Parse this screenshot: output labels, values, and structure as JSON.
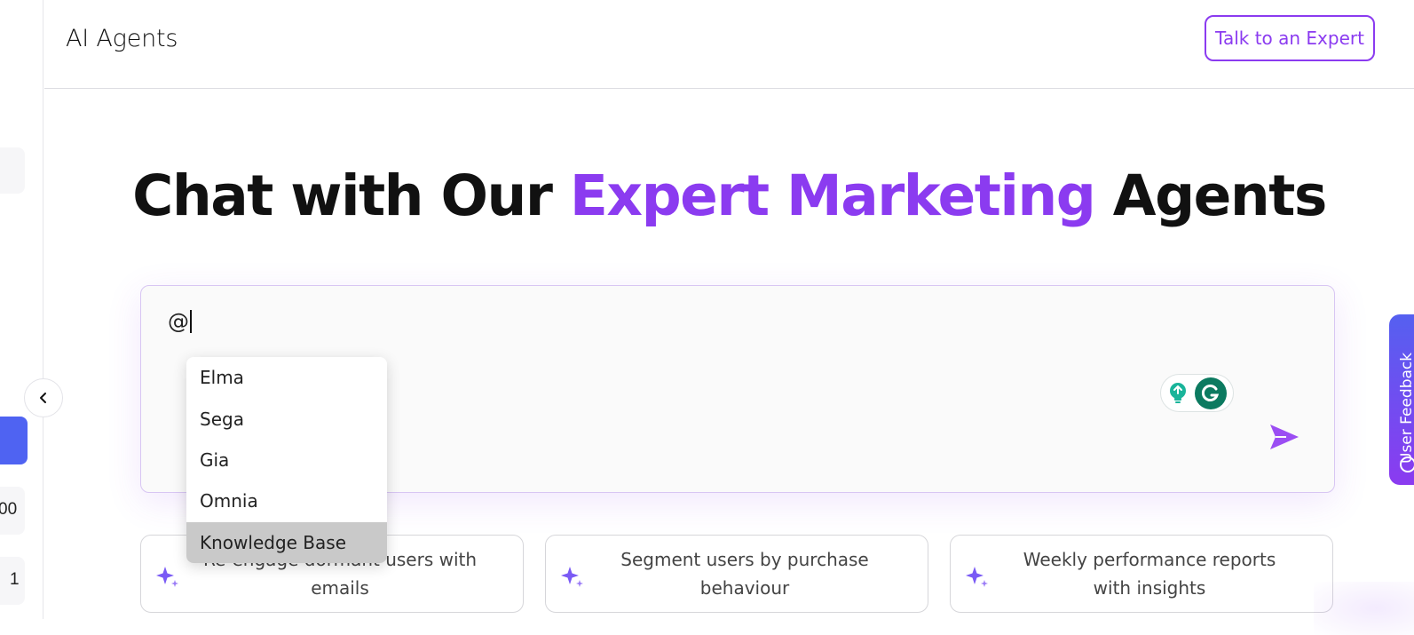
{
  "header": {
    "title": "AI Agents",
    "expert_button": "Talk to an Expert"
  },
  "hero": {
    "part1": "Chat with Our ",
    "accent": "Expert Marketing",
    "part2": " Agents"
  },
  "chat": {
    "input_value": "@"
  },
  "mention_dropdown": {
    "items": [
      {
        "label": "Elma"
      },
      {
        "label": "Sega"
      },
      {
        "label": "Gia"
      },
      {
        "label": "Omnia"
      },
      {
        "label": "Knowledge Base",
        "highlighted": true
      }
    ]
  },
  "suggestions": [
    {
      "text": "Re-engage dormant users with emails"
    },
    {
      "text": "Segment users by purchase behaviour"
    },
    {
      "text": "Weekly performance reports with insights"
    }
  ],
  "sidebar": {
    "partial_texts": [
      "00",
      "1"
    ]
  },
  "feedback_tab": {
    "label": "User Feedback"
  },
  "colors": {
    "accent": "#8b3bf0",
    "sidebar_active": "#4f63f2",
    "grammarly": "#0c7a60",
    "highlight": "#c9c9c9"
  },
  "icons": {
    "collapse": "chevron-left-icon",
    "send": "send-icon",
    "sparkle": "sparkle-icon",
    "grammarly_bulb": "lightbulb-icon",
    "grammarly_logo": "grammarly-icon",
    "feedback": "chat-bubble-icon"
  }
}
